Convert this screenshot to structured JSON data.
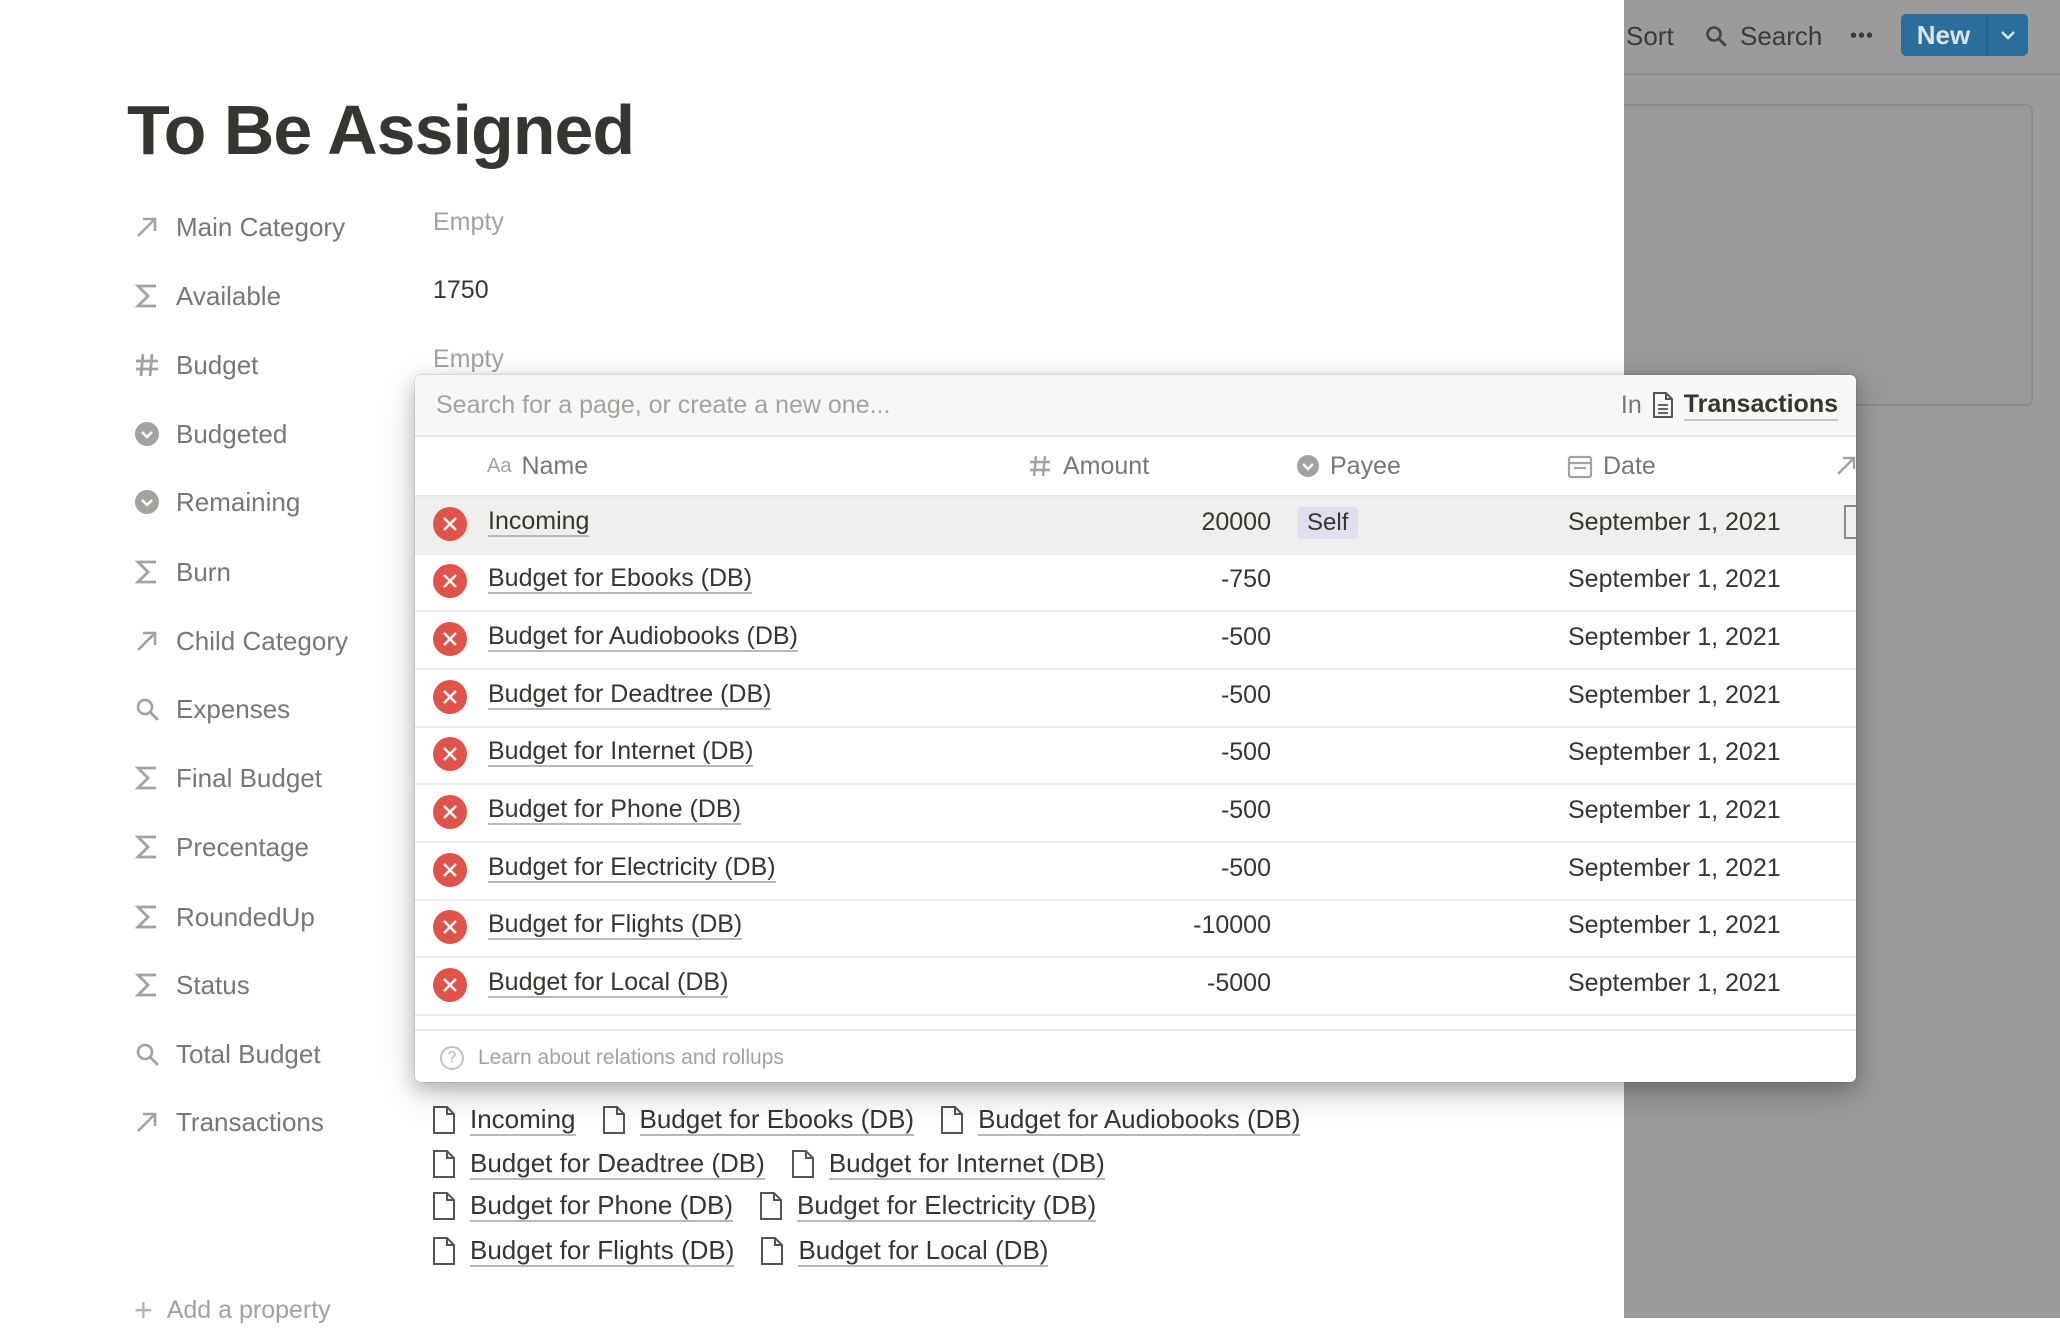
{
  "toolbar": {
    "sort_label": "Sort",
    "search_label": "Search",
    "more_label": "•••",
    "new_label": "New"
  },
  "page": {
    "title": "To Be Assigned",
    "properties": [
      {
        "name": "Main Category",
        "icon": "arrow-up-right-icon",
        "value": "Empty",
        "empty": true
      },
      {
        "name": "Available",
        "icon": "sigma-icon",
        "value": "1750",
        "empty": false
      },
      {
        "name": "Budget",
        "icon": "hash-icon",
        "value": "Empty",
        "empty": true
      },
      {
        "name": "Budgeted",
        "icon": "circle-chevron-icon",
        "value": "",
        "empty": true
      },
      {
        "name": "Remaining",
        "icon": "circle-chevron-icon",
        "value": "",
        "empty": true
      },
      {
        "name": "Burn",
        "icon": "sigma-icon",
        "value": "",
        "empty": true
      },
      {
        "name": "Child Category",
        "icon": "arrow-up-right-icon",
        "value": "",
        "empty": true
      },
      {
        "name": "Expenses",
        "icon": "search-icon",
        "value": "",
        "empty": true
      },
      {
        "name": "Final Budget",
        "icon": "sigma-icon",
        "value": "",
        "empty": true
      },
      {
        "name": "Precentage",
        "icon": "sigma-icon",
        "value": "",
        "empty": true
      },
      {
        "name": "RoundedUp",
        "icon": "sigma-icon",
        "value": "",
        "empty": true
      },
      {
        "name": "Status",
        "icon": "sigma-icon",
        "value": "",
        "empty": true
      },
      {
        "name": "Total Budget",
        "icon": "search-icon",
        "value": "",
        "empty": true
      },
      {
        "name": "Transactions",
        "icon": "arrow-up-right-icon",
        "value": "",
        "empty": true
      }
    ],
    "transaction_links": [
      [
        "Incoming",
        "Budget for Ebooks (DB)",
        "Budget for Audiobooks (DB)"
      ],
      [
        "Budget for Deadtree (DB)",
        "Budget for Internet (DB)"
      ],
      [
        "Budget for Phone (DB)",
        "Budget for Electricity (DB)"
      ],
      [
        "Budget for Flights (DB)",
        "Budget for Local (DB)"
      ]
    ],
    "add_property_label": "Add a property"
  },
  "popup": {
    "search_placeholder": "Search for a page, or create a new one...",
    "in_label": "In",
    "database_name": "Transactions",
    "columns": {
      "name": "Name",
      "amount": "Amount",
      "payee": "Payee",
      "date": "Date"
    },
    "rows": [
      {
        "name": "Incoming",
        "amount": "20000",
        "payee": "Self",
        "date": "September 1, 2021"
      },
      {
        "name": "Budget for Ebooks (DB)",
        "amount": "-750",
        "payee": "",
        "date": "September 1, 2021"
      },
      {
        "name": "Budget for Audiobooks (DB)",
        "amount": "-500",
        "payee": "",
        "date": "September 1, 2021"
      },
      {
        "name": "Budget for Deadtree (DB)",
        "amount": "-500",
        "payee": "",
        "date": "September 1, 2021"
      },
      {
        "name": "Budget for Internet (DB)",
        "amount": "-500",
        "payee": "",
        "date": "September 1, 2021"
      },
      {
        "name": "Budget for Phone (DB)",
        "amount": "-500",
        "payee": "",
        "date": "September 1, 2021"
      },
      {
        "name": "Budget for Electricity (DB)",
        "amount": "-500",
        "payee": "",
        "date": "September 1, 2021"
      },
      {
        "name": "Budget for Flights (DB)",
        "amount": "-10000",
        "payee": "",
        "date": "September 1, 2021"
      },
      {
        "name": "Budget for Local (DB)",
        "amount": "-5000",
        "payee": "",
        "date": "September 1, 2021"
      }
    ],
    "footer_label": "Learn about relations and rollups"
  },
  "colors": {
    "accent_new_button": "#2a6f9c",
    "remove_red": "#e0534a",
    "payee_tag": "#e3deef",
    "overlay_gray": "#9b9b9b"
  }
}
